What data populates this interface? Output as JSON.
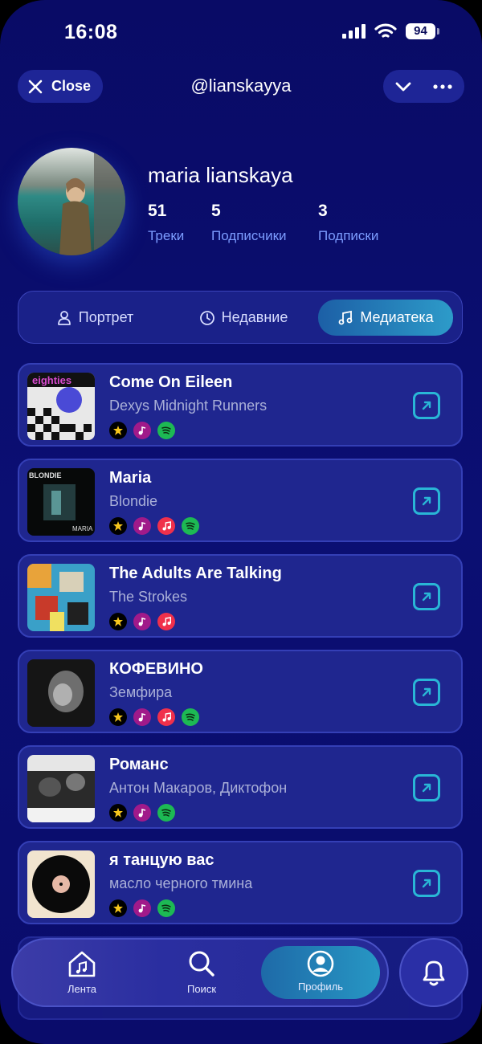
{
  "status": {
    "time": "16:08",
    "battery": "94"
  },
  "header": {
    "close_label": "Close",
    "handle": "@lianskayya"
  },
  "profile": {
    "name": "maria lianskaya",
    "stats": [
      {
        "value": "51",
        "label": "Треки"
      },
      {
        "value": "5",
        "label": "Подписчики"
      },
      {
        "value": "3",
        "label": "Подписки"
      }
    ]
  },
  "tabs": [
    {
      "label": "Портрет",
      "icon": "person-icon",
      "active": false
    },
    {
      "label": "Недавние",
      "icon": "clock-icon",
      "active": false
    },
    {
      "label": "Медиатека",
      "icon": "music-note-icon",
      "active": true
    }
  ],
  "tracks": [
    {
      "title": "Come On Eileen",
      "artist": "Dexys Midnight Runners",
      "cover_text": "eighties",
      "services": [
        "yandex",
        "yamusic",
        "spotify"
      ]
    },
    {
      "title": "Maria",
      "artist": "Blondie",
      "cover_text": "BLONDIE",
      "services": [
        "yandex",
        "yamusic",
        "apple",
        "spotify"
      ]
    },
    {
      "title": "The Adults Are Talking",
      "artist": "The Strokes",
      "cover_text": "",
      "services": [
        "yandex",
        "yamusic",
        "apple"
      ]
    },
    {
      "title": "КОФЕВИНО",
      "artist": "Земфира",
      "cover_text": "",
      "services": [
        "yandex",
        "yamusic",
        "apple",
        "spotify"
      ]
    },
    {
      "title": "Романс",
      "artist": "Антон Макаров, Диктофон",
      "cover_text": "",
      "services": [
        "yandex",
        "yamusic",
        "spotify"
      ]
    },
    {
      "title": "я танцую вас",
      "artist": "масло черного тмина",
      "cover_text": "",
      "services": [
        "yandex",
        "yamusic",
        "spotify"
      ]
    }
  ],
  "nav": [
    {
      "label": "Лента",
      "icon": "home-icon",
      "active": false
    },
    {
      "label": "Поиск",
      "icon": "search-icon",
      "active": false
    },
    {
      "label": "Профиль",
      "icon": "profile-icon",
      "active": true
    }
  ],
  "colors": {
    "background": "#0a0d6e",
    "card": "#1f268f",
    "accent": "#29b6d6",
    "stat_label": "#7c9cff"
  }
}
